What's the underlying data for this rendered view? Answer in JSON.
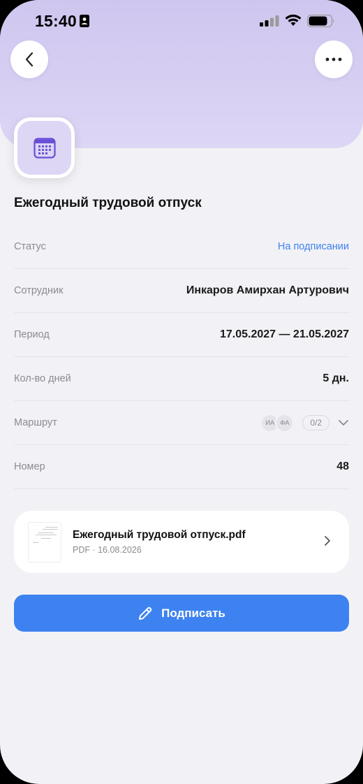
{
  "status_bar": {
    "time": "15:40"
  },
  "document": {
    "title": "Ежегодный трудовой отпуск"
  },
  "details": {
    "status": {
      "label": "Статус",
      "value": "На подписании"
    },
    "employee": {
      "label": "Сотрудник",
      "value": "Инкаров Амирхан Артурович"
    },
    "period": {
      "label": "Период",
      "value": "17.05.2027 — 21.05.2027"
    },
    "days": {
      "label": "Кол-во дней",
      "value": "5 дн."
    },
    "route": {
      "label": "Маршрут",
      "approvers": [
        "ИА",
        "ФА"
      ],
      "progress": "0/2"
    },
    "number": {
      "label": "Номер",
      "value": "48"
    }
  },
  "file": {
    "name": "Ежегодный трудовой отпуск.pdf",
    "meta": "PDF · 16.08.2026"
  },
  "actions": {
    "sign_label": "Подписать"
  },
  "colors": {
    "header_bg": "#d8d0f3",
    "accent": "#3d82f0",
    "icon_purple": "#6a4fd6"
  },
  "icons": {
    "back": "chevron-left-icon",
    "more": "more-horizontal-icon",
    "document_type": "calendar-icon",
    "route_expand": "chevron-down-icon",
    "file_open": "chevron-right-icon",
    "sign": "pencil-icon"
  }
}
